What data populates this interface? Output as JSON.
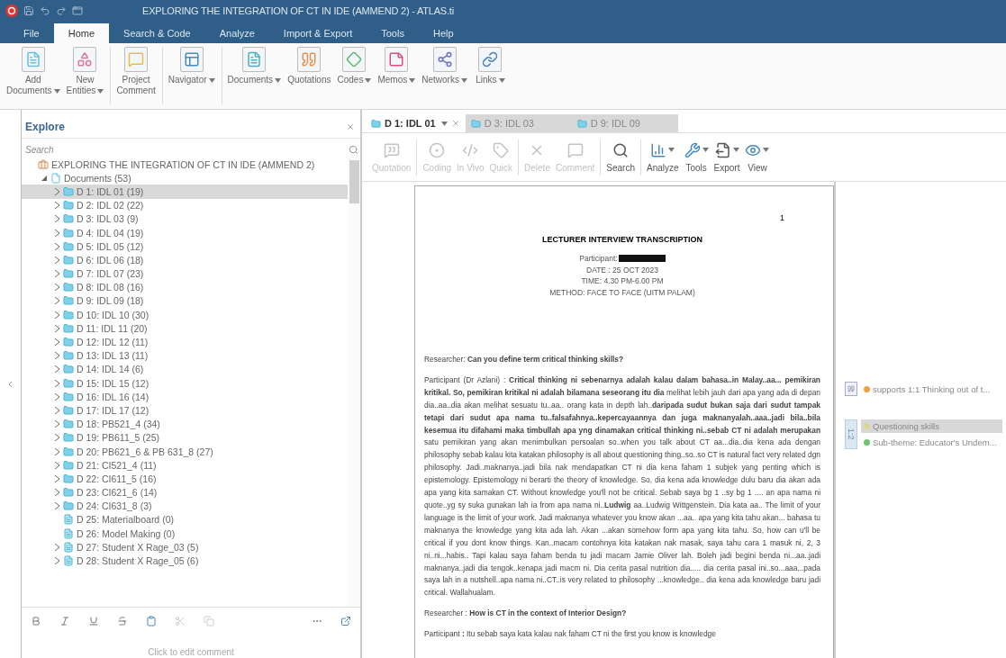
{
  "window": {
    "title": "EXPLORING THE INTEGRATION OF CT IN IDE (AMMEND 2) - ATLAS.ti"
  },
  "menu_tabs": [
    {
      "label": "File",
      "selected": false
    },
    {
      "label": "Home",
      "selected": true
    },
    {
      "label": "Search & Code",
      "selected": false
    },
    {
      "label": "Analyze",
      "selected": false
    },
    {
      "label": "Import & Export",
      "selected": false
    },
    {
      "label": "Tools",
      "selected": false
    },
    {
      "label": "Help",
      "selected": false
    }
  ],
  "ribbon": [
    {
      "label": "Add\nDocuments",
      "dropdown": true
    },
    {
      "label": "New\nEntities",
      "dropdown": true
    },
    {
      "label": "Project\nComment",
      "dropdown": false
    },
    {
      "label": "Navigator",
      "dropdown": true
    },
    {
      "label": "Documents",
      "dropdown": true
    },
    {
      "label": "Quotations",
      "dropdown": false
    },
    {
      "label": "Codes",
      "dropdown": true
    },
    {
      "label": "Memos",
      "dropdown": true
    },
    {
      "label": "Networks",
      "dropdown": true
    },
    {
      "label": "Links",
      "dropdown": true
    }
  ],
  "explorer": {
    "title": "Explore",
    "search": {
      "placeholder": "Search"
    },
    "tree": [
      {
        "label": "EXPLORING THE INTEGRATION OF CT IN IDE (AMMEND 2)",
        "kind": "project",
        "children": [
          {
            "label": "Documents (53)",
            "kind": "group",
            "expanded": true,
            "children": [
              {
                "label": "D 1: IDL 01 (19)",
                "kind": "folder",
                "expanded": false,
                "selected": true
              },
              {
                "label": "D 2: IDL 02 (22)",
                "kind": "folder",
                "expanded": false,
                "selected": false
              },
              {
                "label": "D 3: IDL 03 (9)",
                "kind": "folder",
                "expanded": false,
                "selected": false
              },
              {
                "label": "D 4: IDL 04 (19)",
                "kind": "folder",
                "expanded": false,
                "selected": false
              },
              {
                "label": "D 5: IDL 05 (12)",
                "kind": "folder",
                "expanded": false,
                "selected": false
              },
              {
                "label": "D 6: IDL 06 (18)",
                "kind": "folder",
                "expanded": false,
                "selected": false
              },
              {
                "label": "D 7: IDL 07 (23)",
                "kind": "folder",
                "expanded": false,
                "selected": false
              },
              {
                "label": "D 8: IDL 08 (16)",
                "kind": "folder",
                "expanded": false,
                "selected": false
              },
              {
                "label": "D 9: IDL 09 (18)",
                "kind": "folder",
                "expanded": false,
                "selected": false
              },
              {
                "label": "D 10: IDL 10 (30)",
                "kind": "folder",
                "expanded": false,
                "selected": false
              },
              {
                "label": "D 11: IDL 11 (20)",
                "kind": "folder",
                "expanded": false,
                "selected": false
              },
              {
                "label": "D 12: IDL 12 (11)",
                "kind": "folder",
                "expanded": false,
                "selected": false
              },
              {
                "label": "D 13: IDL 13 (11)",
                "kind": "folder",
                "expanded": false,
                "selected": false
              },
              {
                "label": "D 14: IDL 14 (6)",
                "kind": "folder",
                "expanded": false,
                "selected": false
              },
              {
                "label": "D 15: IDL 15 (12)",
                "kind": "folder",
                "expanded": false,
                "selected": false
              },
              {
                "label": "D 16: IDL 16 (14)",
                "kind": "folder",
                "expanded": false,
                "selected": false
              },
              {
                "label": "D 17: IDL 17 (12)",
                "kind": "folder",
                "expanded": false,
                "selected": false
              },
              {
                "label": "D 18: PB521_4 (34)",
                "kind": "folder",
                "expanded": false,
                "selected": false
              },
              {
                "label": "D 19: PB611_5 (25)",
                "kind": "folder",
                "expanded": false,
                "selected": false
              },
              {
                "label": "D 20: PB621_6 & PB 631_8 (27)",
                "kind": "folder",
                "expanded": false,
                "selected": false
              },
              {
                "label": "D 21: CI521_4 (11)",
                "kind": "folder",
                "expanded": false,
                "selected": false
              },
              {
                "label": "D 22: CI611_5 (16)",
                "kind": "folder",
                "expanded": false,
                "selected": false
              },
              {
                "label": "D 23: CI621_6 (14)",
                "kind": "folder",
                "expanded": false,
                "selected": false
              },
              {
                "label": "D 24: CI631_8 (3)",
                "kind": "folder",
                "expanded": false,
                "selected": false
              },
              {
                "label": "D 25: Materialboard (0)",
                "kind": "file",
                "selected": false
              },
              {
                "label": "D 26: Model Making (0)",
                "kind": "file",
                "selected": false
              },
              {
                "label": "D 27: Student X Rage_03 (5)",
                "kind": "file",
                "expanded": false,
                "selected": false
              },
              {
                "label": "D 28: Student X Rage_05 (6)",
                "kind": "file",
                "expanded": false,
                "selected": false
              }
            ]
          }
        ]
      }
    ]
  },
  "comment": {
    "placeholder": "Click to edit comment"
  },
  "doc_tabs": [
    {
      "label": "D 1: IDL 01",
      "selected": true
    },
    {
      "label": "D 3: IDL 03",
      "selected": false
    },
    {
      "label": "D 9: IDL 09",
      "selected": false
    }
  ],
  "doc_toolbar": [
    {
      "label": "Quotation",
      "disabled": true,
      "dropdown": false
    },
    {
      "label": "Coding",
      "disabled": true,
      "dropdown": false
    },
    {
      "label": "In Vivo",
      "disabled": true,
      "dropdown": false
    },
    {
      "label": "Quick",
      "disabled": true,
      "dropdown": false
    },
    {
      "label": "Delete",
      "disabled": true,
      "dropdown": false
    },
    {
      "label": "Comment",
      "disabled": true,
      "dropdown": false
    },
    {
      "label": "Search",
      "disabled": false,
      "dropdown": false
    },
    {
      "label": "Analyze",
      "disabled": false,
      "dropdown": true
    },
    {
      "label": "Tools",
      "disabled": false,
      "dropdown": true
    },
    {
      "label": "Export",
      "disabled": false,
      "dropdown": true
    },
    {
      "label": "View",
      "disabled": false,
      "dropdown": true
    }
  ],
  "document": {
    "page_number": "1",
    "title": "LECTURER INTERVIEW TRANSCRIPTION",
    "header_lines": [
      "Participant:",
      "DATE : 25 OCT 2023",
      "TIME: 4.30 PM-6.00 PM",
      "METHOD: FACE TO FACE (UITM PALAM)"
    ],
    "paragraphs": [
      {
        "speaker": "Researcher:",
        "text": "**Can you define term critical thinking skills?**"
      },
      {
        "speaker": "Participant (Dr Azlani) :",
        "text": "**Critical thinking ni sebenarnya adalah kalau dalam bahasa..in Malay..aa... pemikiran kritikal. So, pemikiran kritikal ni adalah bilamana seseorang itu dia** melihat lebih jauh dari apa yang ada di depan dia..aa..dia akan melihat sesuatu tu..aa.. orang kata in depth lah..**daripada sudut bukan saja dari sudut tampak tetapi dari sudut apa nama tu..falsafahnya..kepercayaannya dan juga maknanyalah..aaa..jadi bila..bila kesemua itu difahami maka timbullah apa yng dinamakan critical thinking ni..sebab CT ni adalah merupakan** satu pemikiran yang akan menimbulkan persoalan so..when you talk about CT aa...dia..dia kena ada dengan philosophy sebab kalau kita katakan philosophy is all about questioning thing..so..so CT is natural fact very related dgn philosophy. Jadi..maknanya..jadi bila nak mendapatkan CT ni dia kena faham 1 subjek yang penting which is epistemology. Epistemology ni berarti the theory of knowledge. So, dia kena ada knowledge dulu baru dia akan ada apa yang kita samakan CT. Without knowledge you'll not be critical. Sebab saya bg 1 ..sy bg 1 .... an apa nama ni quote..yg sy suka gunakan lah ia from apa nama ni..**Ludwig** aa..Ludwig Wittgenstein. Dia kata aa.. The limit of your language is the limit of your work. Jadi maknanya whatever you know akan ...aa.. apa yang kita tahu akan... bahasa tu maknanya the knowledge yang kita ada lah. Akan ...akan somehow form apa yang kita tahu. So, how can u'll be critical if you dont know things. Kan..macam contohnya kita katakan nak masak, saya tahu cara 1 masuk ni, 2, 3 ni..ni...habis.. Tapi kalau saya faham benda tu jadi macam Jamie Oliver lah. Boleh jadi begini benda ni...aa..jadi maknanya..jadi dia tengok..kenapa jadi macm ni. Dia cerita pasal nutrition dia..... dia cerita pasal ini..so...aaa...pada saya lah in a nutshell..apa nama ni..CT..is very related to philosophy ...knowledge.. dia kena ada knowledge baru jadi critical. Wallahualam."
      },
      {
        "speaker": "Researcher :",
        "text": "**How is CT in the context of Interior Design?**"
      },
      {
        "speaker": "Participant",
        "text": "**:** Itu sebab saya kata kalau nak faham CT ni the first you know is knowledge"
      }
    ]
  },
  "margin": [
    {
      "kind": "relation",
      "label": "supports 1:1 Thinking out of t...",
      "color": "#f0a040",
      "selected": false
    },
    {
      "kind": "quotation",
      "tag": "1:2",
      "codes": [
        {
          "label": "Questioning skills",
          "color": "#d8d890",
          "selected": true
        },
        {
          "label": "Sub-theme: Educator's Undem...",
          "color": "#6cc46c",
          "selected": false
        }
      ]
    }
  ]
}
